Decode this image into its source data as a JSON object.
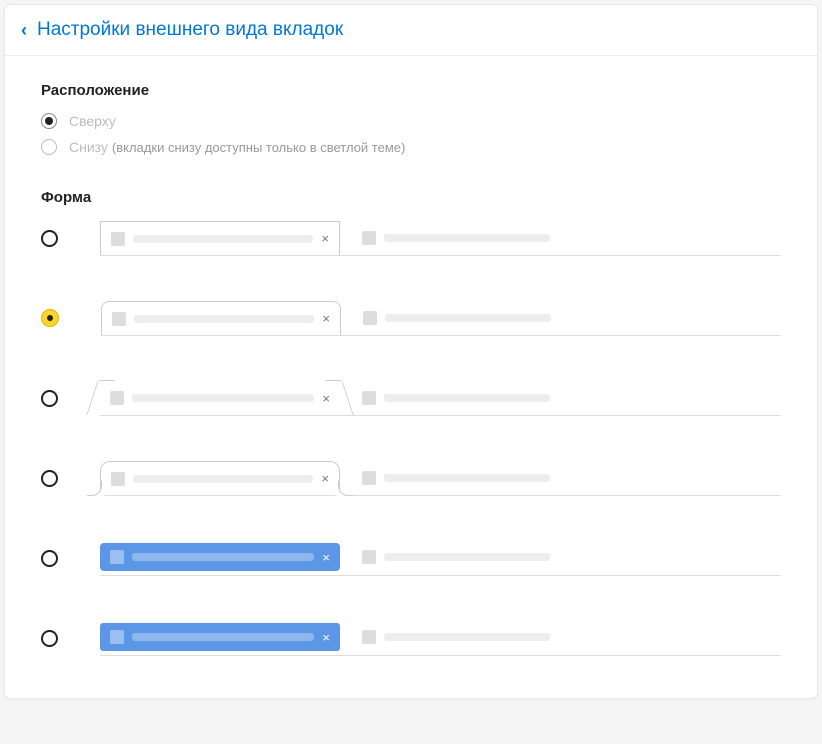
{
  "header": {
    "title": "Настройки внешнего вида вкладок"
  },
  "position": {
    "title": "Расположение",
    "top_label": "Сверху",
    "bottom_label": "Снизу",
    "bottom_hint": "(вкладки снизу доступны только в светлой теме)",
    "selected": "top"
  },
  "shape": {
    "title": "Форма",
    "selected_index": 1,
    "close_glyph": "×"
  }
}
